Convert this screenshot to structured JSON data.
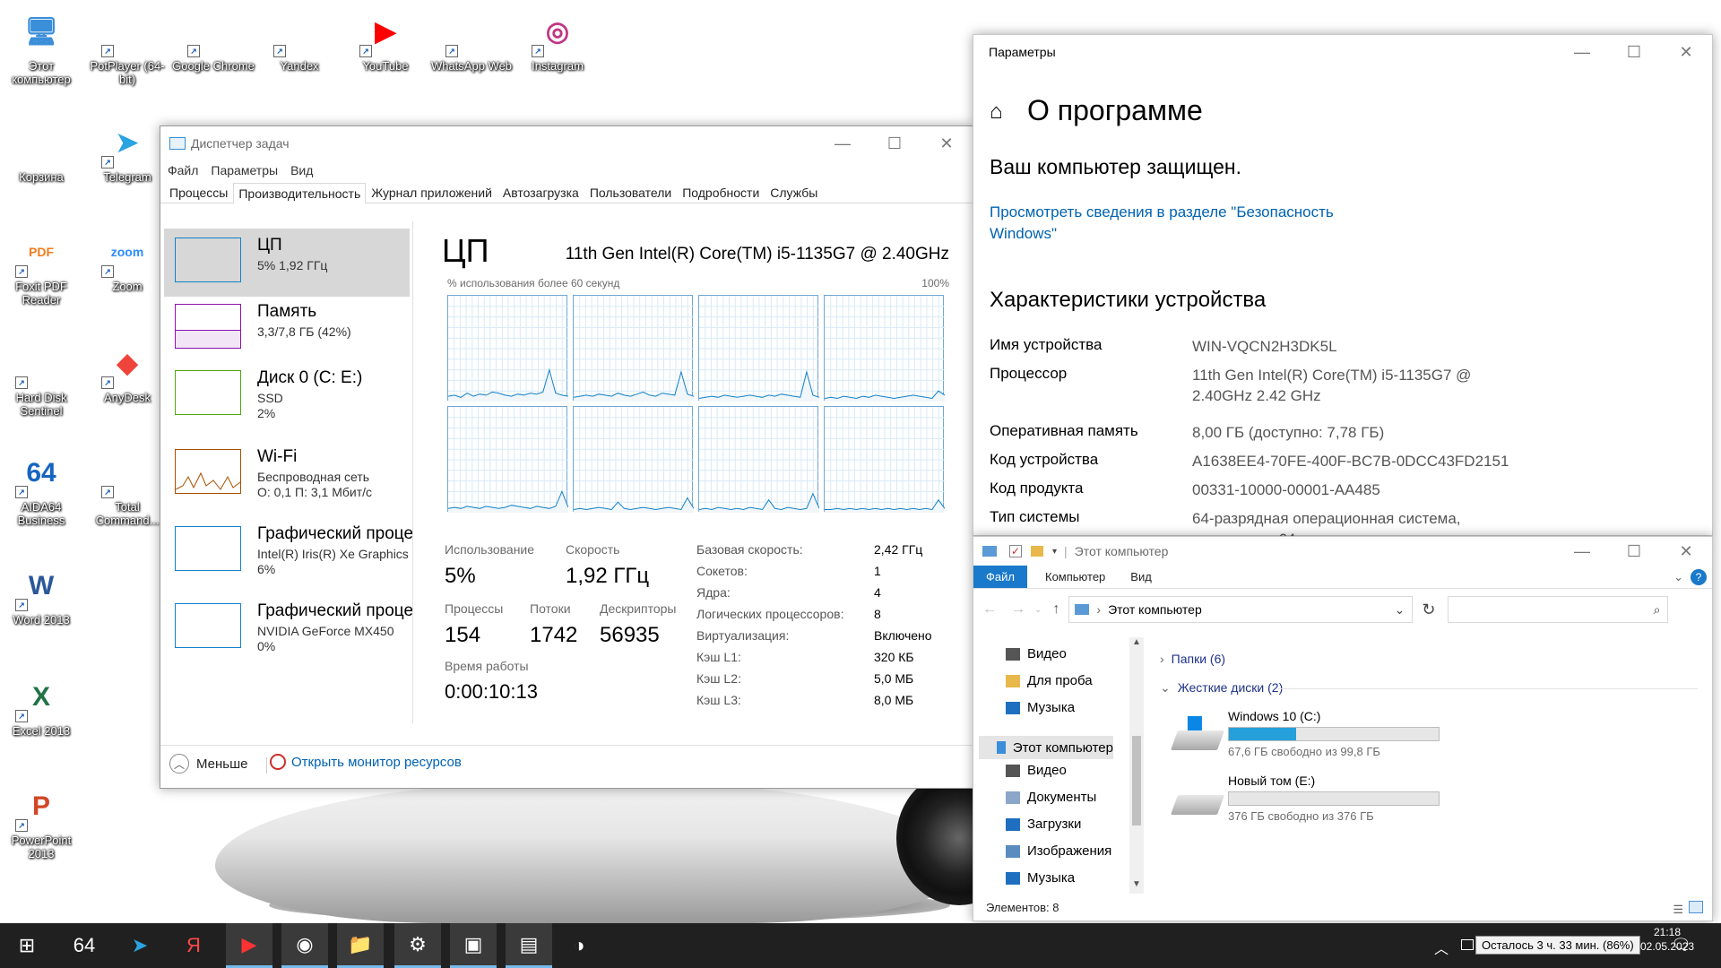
{
  "desktop": {
    "icons": [
      {
        "label": "Этот компьютер",
        "glyph": "🖥",
        "color": "#3b8ed8"
      },
      {
        "label": "PotPlayer (64-bit)",
        "glyph": "▷",
        "color": "#ffffff"
      },
      {
        "label": "Google Chrome",
        "glyph": "◉",
        "color": "#ffffff"
      },
      {
        "label": "Yandex",
        "glyph": "Y",
        "color": "#ffffff"
      },
      {
        "label": "YouTube",
        "glyph": "▶",
        "color": "#ff0000"
      },
      {
        "label": "WhatsApp Web",
        "glyph": "✆",
        "color": "#ffffff"
      },
      {
        "label": "Instagram",
        "glyph": "◎",
        "color": "#c13584"
      },
      {
        "label": "Корзина",
        "glyph": "♻",
        "color": "#ffffff"
      },
      {
        "label": "Telegram",
        "glyph": "➤",
        "color": "#2aa3e0"
      },
      {
        "label": "Foxit PDF Reader",
        "glyph": "PDF",
        "color": "#f07d1e"
      },
      {
        "label": "Zoom",
        "glyph": "zoom",
        "color": "#2d8cff"
      },
      {
        "label": "Hard Disk Sentinel",
        "glyph": "◐",
        "color": "#ffffff"
      },
      {
        "label": "AnyDesk",
        "glyph": "◆",
        "color": "#ef443b"
      },
      {
        "label": "AIDA64 Business",
        "glyph": "64",
        "color": "#1565c0"
      },
      {
        "label": "Total Command...",
        "glyph": "64",
        "color": "#ffffff"
      },
      {
        "label": "Word 2013",
        "glyph": "W",
        "color": "#2b579a"
      },
      {
        "label": "Excel 2013",
        "glyph": "X",
        "color": "#217346"
      },
      {
        "label": "PowerPoint 2013",
        "glyph": "P",
        "color": "#d24726"
      }
    ]
  },
  "task_manager": {
    "title": "Диспетчер задач",
    "menu": [
      "Файл",
      "Параметры",
      "Вид"
    ],
    "tabs": [
      "Процессы",
      "Производительность",
      "Журнал приложений",
      "Автозагрузка",
      "Пользователи",
      "Подробности",
      "Службы"
    ],
    "sidebar": [
      {
        "name": "ЦП",
        "sub1": "5% 1,92 ГГц",
        "sub2": "",
        "sub3": "",
        "color": "#1181c8"
      },
      {
        "name": "Память",
        "sub1": "3,3/7,8 ГБ (42%)",
        "sub2": "",
        "sub3": "",
        "color": "#8b12ae"
      },
      {
        "name": "Диск 0 (C: E:)",
        "sub1": "SSD",
        "sub2": "2%",
        "sub3": "",
        "color": "#4da60c"
      },
      {
        "name": "Wi-Fi",
        "sub1": "Беспроводная сеть",
        "sub2": "О: 0,1 П: 3,1 Мбит/с",
        "sub3": "",
        "color": "#a74f01"
      },
      {
        "name": "Графический проце",
        "sub1": "Intel(R) Iris(R) Xe Graphics",
        "sub2": "6%",
        "sub3": "",
        "color": "#1181c8"
      },
      {
        "name": "Графический проце",
        "sub1": "NVIDIA GeForce MX450",
        "sub2": "0%",
        "sub3": "",
        "color": "#1181c8"
      }
    ],
    "cpu_title": "ЦП",
    "cpu_model": "11th Gen Intel(R) Core(TM) i5-1135G7 @ 2.40GHz",
    "graph_caption": "% использования более 60 секунд",
    "graph_max": "100%",
    "cores_usage": [
      [
        5,
        6,
        4,
        8,
        5,
        7,
        6,
        9,
        8,
        6,
        5,
        7,
        6,
        8,
        7,
        9,
        30,
        8,
        6,
        5
      ],
      [
        4,
        5,
        6,
        5,
        7,
        6,
        5,
        8,
        6,
        5,
        7,
        9,
        6,
        5,
        8,
        7,
        6,
        28,
        7,
        5
      ],
      [
        3,
        4,
        5,
        4,
        6,
        5,
        4,
        5,
        6,
        5,
        4,
        6,
        5,
        7,
        6,
        5,
        4,
        28,
        6,
        4
      ],
      [
        3,
        4,
        3,
        5,
        4,
        3,
        5,
        4,
        6,
        5,
        4,
        3,
        4,
        5,
        6,
        5,
        4,
        3,
        10,
        6
      ],
      [
        4,
        5,
        4,
        6,
        5,
        4,
        6,
        5,
        4,
        5,
        7,
        6,
        5,
        4,
        6,
        5,
        4,
        6,
        20,
        5
      ],
      [
        3,
        4,
        3,
        4,
        5,
        4,
        3,
        10,
        4,
        3,
        4,
        5,
        4,
        3,
        4,
        5,
        4,
        3,
        14,
        4
      ],
      [
        3,
        4,
        3,
        5,
        4,
        3,
        4,
        3,
        5,
        4,
        3,
        12,
        4,
        3,
        5,
        4,
        3,
        4,
        18,
        4
      ],
      [
        3,
        3,
        4,
        3,
        4,
        3,
        4,
        3,
        4,
        3,
        4,
        3,
        4,
        3,
        4,
        3,
        4,
        3,
        12,
        4
      ]
    ],
    "stats": {
      "usage_label": "Использование",
      "usage": "5%",
      "speed_label": "Скорость",
      "speed": "1,92 ГГц",
      "proc_label": "Процессы",
      "proc": "154",
      "threads_label": "Потоки",
      "threads": "1742",
      "handles_label": "Дескрипторы",
      "handles": "56935",
      "uptime_label": "Время работы",
      "uptime": "0:00:10:13"
    },
    "specs": [
      {
        "k": "Базовая скорость:",
        "v": "2,42 ГГц"
      },
      {
        "k": "Сокетов:",
        "v": "1"
      },
      {
        "k": "Ядра:",
        "v": "4"
      },
      {
        "k": "Логических процессоров:",
        "v": "8"
      },
      {
        "k": "Виртуализация:",
        "v": "Включено"
      },
      {
        "k": "Кэш L1:",
        "v": "320 КБ"
      },
      {
        "k": "Кэш L2:",
        "v": "5,0 МБ"
      },
      {
        "k": "Кэш L3:",
        "v": "8,0 МБ"
      }
    ],
    "less": "Меньше",
    "resmon": "Открыть монитор ресурсов"
  },
  "settings": {
    "title": "Параметры",
    "page_title": "О программе",
    "protected": "Ваш компьютер защищен.",
    "link_line1": "Просмотреть сведения в разделе \"Безопасность",
    "link_line2": "Windows\"",
    "section": "Характеристики устройства",
    "rows": [
      {
        "k": "Имя устройства",
        "v1": "WIN-VQCN2H3DK5L",
        "v2": ""
      },
      {
        "k": "Процессор",
        "v1": "11th Gen Intel(R) Core(TM) i5-1135G7 @",
        "v2": "2.40GHz   2.42 GHz"
      },
      {
        "k": "Оперативная память",
        "v1": "8,00 ГБ (доступно: 7,78 ГБ)",
        "v2": ""
      },
      {
        "k": "Код устройства",
        "v1": "A1638EE4-70FE-400F-BC7B-0DCC43FD2151",
        "v2": ""
      },
      {
        "k": "Код продукта",
        "v1": "00331-10000-00001-AA485",
        "v2": ""
      },
      {
        "k": "Тип системы",
        "v1": "64-разрядная операционная система,",
        "v2": "процессор x64"
      }
    ]
  },
  "explorer": {
    "title": "Этот компьютер",
    "ribbon_tabs": [
      "Файл",
      "Компьютер",
      "Вид"
    ],
    "address": "Этот компьютер",
    "search_placeholder": "",
    "tree": [
      {
        "label": "Видео",
        "color": "#555555",
        "indent": 0
      },
      {
        "label": "Для проба",
        "color": "#e8b84a",
        "indent": 0
      },
      {
        "label": "Музыка",
        "color": "#1f6fc1",
        "indent": 0
      },
      {
        "label": "Этот компьютер",
        "color": "#3b8ed8",
        "indent": -10
      },
      {
        "label": "Видео",
        "color": "#555555",
        "indent": 0
      },
      {
        "label": "Документы",
        "color": "#8aa6c8",
        "indent": 0
      },
      {
        "label": "Загрузки",
        "color": "#1f6fc1",
        "indent": 0
      },
      {
        "label": "Изображения",
        "color": "#5a8cc0",
        "indent": 0
      },
      {
        "label": "Музыка",
        "color": "#1f6fc1",
        "indent": 0
      }
    ],
    "folders_group": "Папки (6)",
    "drives_group": "Жесткие диски (2)",
    "drives": [
      {
        "name": "Windows 10 (C:)",
        "free": "67,6 ГБ свободно из 99,8 ГБ",
        "used_fraction": 0.32
      },
      {
        "name": "Новый том (E:)",
        "free": "376 ГБ свободно из 376 ГБ",
        "used_fraction": 0.0
      }
    ],
    "status": "Элементов: 8"
  },
  "taskbar": {
    "apps": [
      "⊞",
      "64",
      "➤",
      "Я",
      "▶",
      "◉",
      "📁",
      "⚙",
      "▣",
      "▤",
      "◑"
    ],
    "battery": "Осталось 3 ч. 33 мин. (86%)",
    "clock_time": "21:18",
    "clock_date": "02.05.2023"
  },
  "colors": {
    "accent": "#0078d7",
    "link": "#0063b1",
    "cpu_line": "#1181c8"
  }
}
